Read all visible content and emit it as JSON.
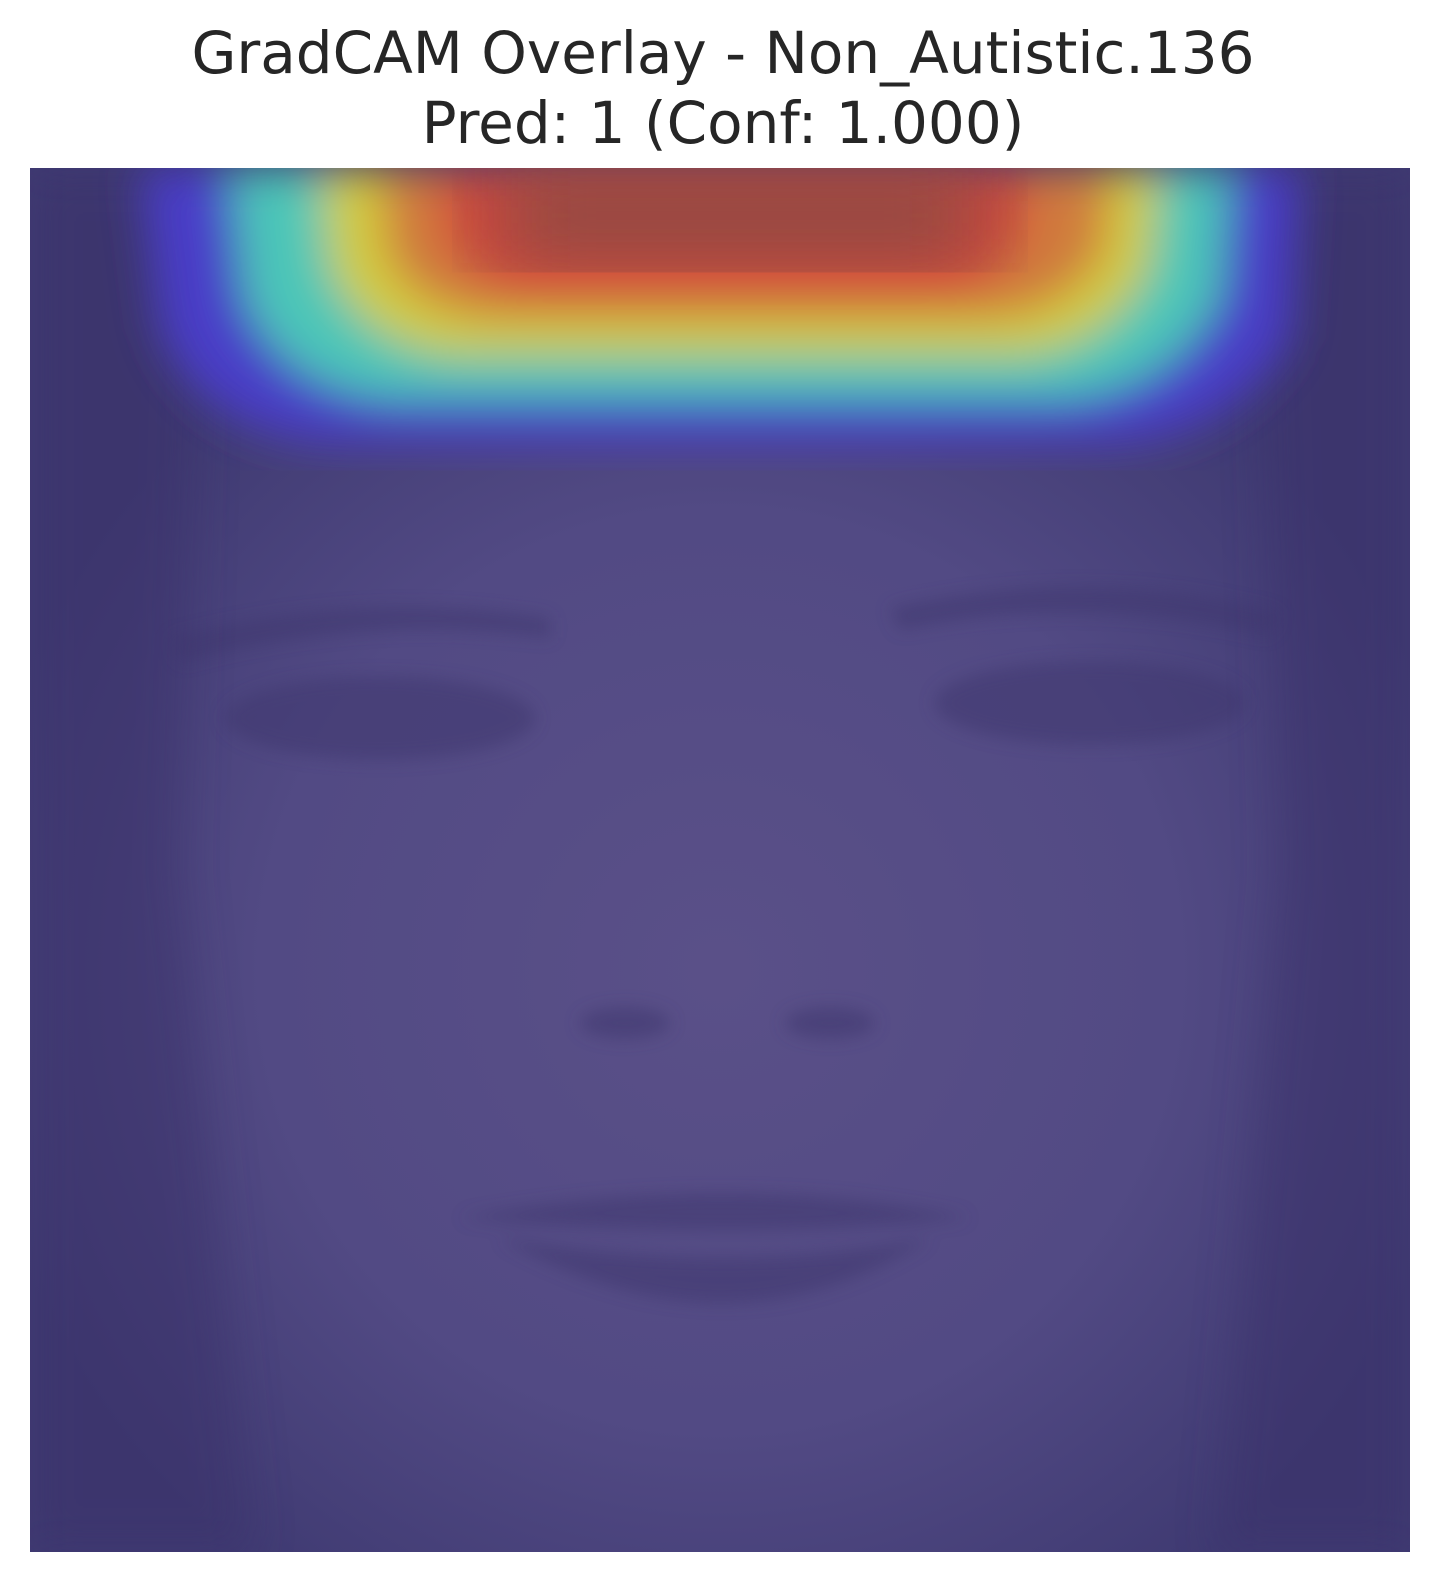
{
  "title": {
    "line1": "GradCAM Overlay - Non_Autistic.136",
    "line2": "Pred: 1 (Conf: 1.000)"
  },
  "image": {
    "description_icon": "face-photo-icon",
    "base_color": "#4f467e",
    "heatmap_colors": {
      "hot": "#8e4a42",
      "red": "#d2483c",
      "orange": "#d07a3c",
      "yellow": "#d2cc3c",
      "cyan": "#4cc6b8",
      "blue": "#4a3ec8"
    }
  }
}
